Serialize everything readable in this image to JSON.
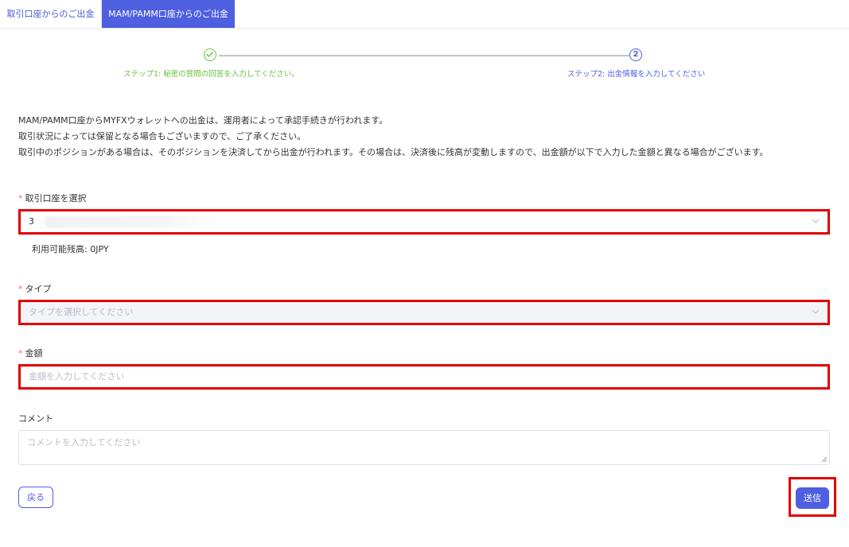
{
  "tabs": [
    {
      "label": "取引口座からのご出金",
      "active": false
    },
    {
      "label": "MAM/PAMM口座からのご出金",
      "active": true
    }
  ],
  "steps": [
    {
      "icon": "check-icon",
      "label": "ステップ1: 秘密の質問の回答を入力してください。",
      "status": "done"
    },
    {
      "number": "2",
      "label": "ステップ2: 出金情報を入力してください",
      "status": "current"
    }
  ],
  "notice": [
    "MAM/PAMM口座からMYFXウォレットへの出金は、運用者によって承認手続きが行われます。",
    "取引状況によっては保留となる場合もございますので、ご了承ください。",
    "取引中のポジションがある場合は、そのポジションを決済してから出金が行われます。その場合は、決済後に残高が変動しますので、出金額が以下で入力した金額と異なる場合がございます。"
  ],
  "form": {
    "required_mark": "*",
    "account": {
      "label": "取引口座を選択",
      "value": "3",
      "available": "利用可能残高: 0JPY"
    },
    "type": {
      "label": "タイプ",
      "placeholder": "タイプを選択してください"
    },
    "amount": {
      "label": "金額",
      "placeholder": "金額を入力してください"
    },
    "comment": {
      "label": "コメント",
      "placeholder": "コメントを入力してください"
    }
  },
  "buttons": {
    "back": "戻る",
    "submit": "送信"
  },
  "colors": {
    "primary": "#4e5fe0",
    "success": "#67c23a",
    "required": "#f56c6c",
    "highlight": "#e00000"
  }
}
